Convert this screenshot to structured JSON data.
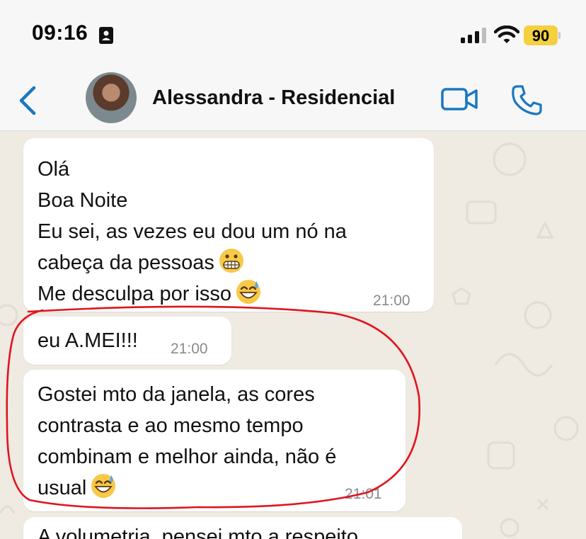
{
  "status_bar": {
    "time": "09:16",
    "battery": "90",
    "icons": [
      "id-card-icon",
      "signal-icon",
      "wifi-icon",
      "battery-icon"
    ]
  },
  "header": {
    "contact_name": "Alessandra - Residencial",
    "icons": [
      "back-chevron-icon",
      "video-call-icon",
      "phone-call-icon"
    ],
    "accent_color": "#1a78c2"
  },
  "messages": [
    {
      "lines": [
        "Olá",
        "Boa Noite",
        "Eu sei, as vezes eu dou um nó na",
        "cabeça da pessoas",
        "Me desculpa por isso"
      ],
      "emojis": [
        "grimacing-face-emoji",
        "sweat-smile-emoji"
      ],
      "time": "21:00"
    },
    {
      "lines": [
        "eu A.MEI!!!"
      ],
      "time": "21:00"
    },
    {
      "lines": [
        "Gostei mto da janela, as cores",
        "contrasta e ao mesmo tempo",
        "combinam e melhor ainda, não é",
        "usual"
      ],
      "emojis": [
        "sweat-smile-emoji"
      ],
      "time": "21:01"
    },
    {
      "lines": [
        "A volumetria, pensei mto a respeito"
      ]
    }
  ],
  "colors": {
    "chat_background": "#efeae2",
    "bubble": "#ffffff",
    "annotation": "#e0141e",
    "battery": "#f4d03f"
  }
}
